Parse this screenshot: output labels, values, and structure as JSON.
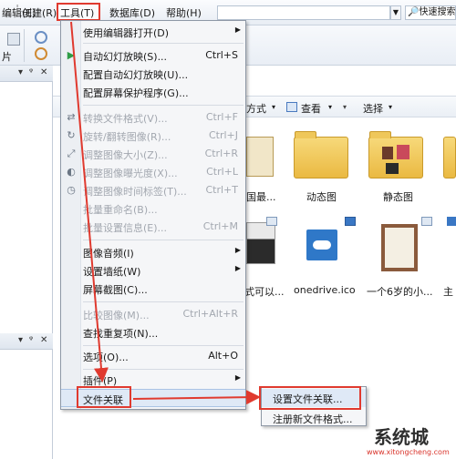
{
  "menubar": {
    "items": [
      {
        "label": "编辑(E)"
      },
      {
        "label": "创建(R)"
      },
      {
        "label": "工具(T)"
      },
      {
        "label": "数据库(D)"
      },
      {
        "label": "帮助(H)"
      }
    ],
    "address_value": "",
    "search_placeholder": "快速搜索"
  },
  "toolbar": {
    "left_label": "片"
  },
  "view_bar": {
    "mode_label": "方式",
    "view_label": "查看",
    "select_label": "选择"
  },
  "thumbnails": [
    {
      "caption": "国最..."
    },
    {
      "caption": "动态图"
    },
    {
      "caption": "静态图"
    },
    {
      "caption": "式可以..."
    },
    {
      "caption": "onedrive.ico"
    },
    {
      "caption": "一个6岁的小..."
    },
    {
      "caption": "主"
    }
  ],
  "tools_menu": {
    "items": [
      {
        "label": "使用编辑器打开(D)",
        "shortcut": "",
        "disabled": false,
        "submenu": true
      },
      {
        "label": "自动幻灯放映(S)...",
        "shortcut": "Ctrl+S",
        "disabled": false,
        "submenu": false
      },
      {
        "label": "配置自动幻灯放映(U)...",
        "shortcut": "",
        "disabled": false,
        "submenu": false
      },
      {
        "label": "配置屏幕保护程序(G)...",
        "shortcut": "",
        "disabled": false,
        "submenu": false
      },
      {
        "label": "转换文件格式(V)...",
        "shortcut": "Ctrl+F",
        "disabled": true,
        "submenu": false
      },
      {
        "label": "旋转/翻转图像(R)...",
        "shortcut": "Ctrl+J",
        "disabled": true,
        "submenu": false
      },
      {
        "label": "调整图像大小(Z)...",
        "shortcut": "Ctrl+R",
        "disabled": true,
        "submenu": false
      },
      {
        "label": "调整图像曝光度(X)...",
        "shortcut": "Ctrl+L",
        "disabled": true,
        "submenu": false
      },
      {
        "label": "调整图像时间标签(T)...",
        "shortcut": "Ctrl+T",
        "disabled": true,
        "submenu": false
      },
      {
        "label": "批量重命名(B)...",
        "shortcut": "",
        "disabled": true,
        "submenu": false
      },
      {
        "label": "批量设置信息(E)...",
        "shortcut": "Ctrl+M",
        "disabled": true,
        "submenu": false
      },
      {
        "label": "图像音频(I)",
        "shortcut": "",
        "disabled": false,
        "submenu": true
      },
      {
        "label": "设置墙纸(W)",
        "shortcut": "",
        "disabled": false,
        "submenu": true
      },
      {
        "label": "屏幕截图(C)...",
        "shortcut": "",
        "disabled": false,
        "submenu": false
      },
      {
        "label": "比较图像(M)...",
        "shortcut": "Ctrl+Alt+R",
        "disabled": true,
        "submenu": false
      },
      {
        "label": "查找重复项(N)...",
        "shortcut": "",
        "disabled": false,
        "submenu": false
      },
      {
        "label": "选项(O)...",
        "shortcut": "Alt+O",
        "disabled": false,
        "submenu": false
      },
      {
        "label": "插件(P)",
        "shortcut": "",
        "disabled": false,
        "submenu": true
      },
      {
        "label": "文件关联",
        "shortcut": "",
        "disabled": false,
        "submenu": false
      }
    ]
  },
  "file_assoc_submenu": {
    "items": [
      {
        "label": "设置文件关联..."
      },
      {
        "label": "注册新文件格式..."
      }
    ]
  },
  "watermark": {
    "text": "系统城",
    "url": "www.xitongcheng.com"
  },
  "colors": {
    "highlight_red": "#e03a2f",
    "folder_yellow": "#eab942"
  }
}
